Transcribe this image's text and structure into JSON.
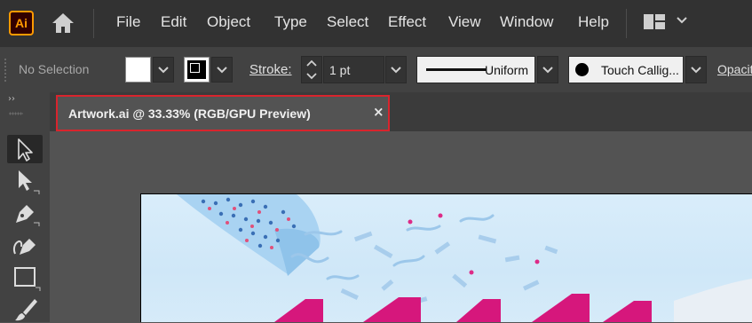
{
  "app": {
    "logo_text": "Ai",
    "brand_color": "#ff9a00"
  },
  "menu": {
    "items": [
      "File",
      "Edit",
      "Object",
      "Type",
      "Select",
      "Effect",
      "View",
      "Window",
      "Help"
    ]
  },
  "control_bar": {
    "selection_status": "No Selection",
    "stroke_label": "Stroke:",
    "stroke_weight": "1 pt",
    "variable_width_profile": "Uniform",
    "brush_definition": "Touch Callig...",
    "opacity_label": "Opacity"
  },
  "document": {
    "tab_title": "Artwork.ai @ 33.33% (RGB/GPU Preview)",
    "close_glyph": "×",
    "highlight_color": "#d9242d"
  },
  "toolbar": {
    "collapse_glyph": "››",
    "tools": [
      "selection-tool",
      "direct-selection-tool",
      "pen-tool",
      "curvature-tool",
      "rectangle-tool",
      "paintbrush-tool"
    ]
  }
}
